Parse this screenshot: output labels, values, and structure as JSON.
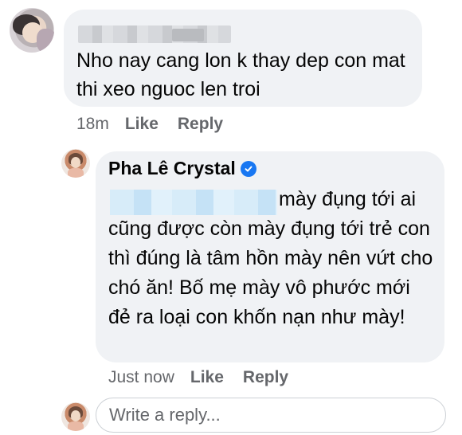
{
  "comment1": {
    "text": "Nho nay cang lon k thay dep con mat thi xeo nguoc len troi",
    "time": "18m",
    "like_label": "Like",
    "reply_label": "Reply"
  },
  "comment2": {
    "author": "Pha Lê Crystal",
    "text_line1": "mày đụng tới",
    "text_rest": "ai cũng được còn mày đụng tới trẻ con thì đúng là tâm hồn mày nên vứt cho chó ăn! Bố mẹ mày vô phước mới đẻ ra loại con khốn nạn như mày!",
    "time": "Just now",
    "like_label": "Like",
    "reply_label": "Reply"
  },
  "reply_box": {
    "placeholder": "Write a reply..."
  },
  "colors": {
    "bubble": "#f0f2f5",
    "meta": "#65676b",
    "verified": "#1877f2"
  },
  "icons": {
    "verified": "verified-badge-icon"
  }
}
